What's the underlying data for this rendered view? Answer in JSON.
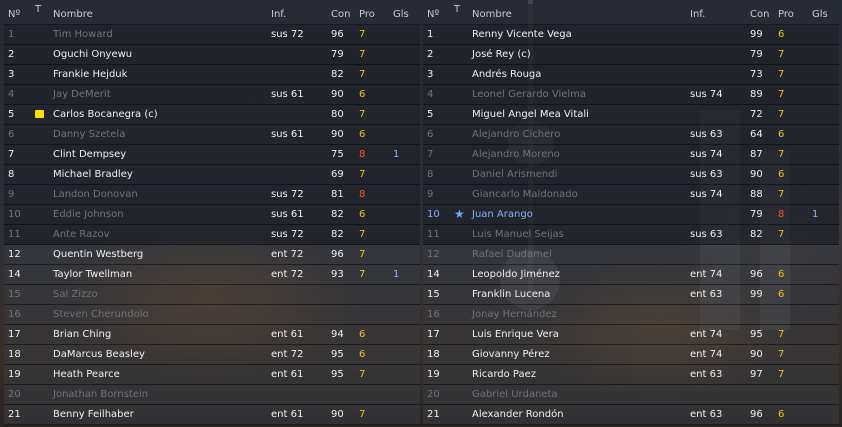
{
  "headers": {
    "no": "Nº",
    "t": "T",
    "name": "Nombre",
    "inf": "Inf.",
    "con": "Con",
    "pro": "Pro",
    "gls": "Gls"
  },
  "colors": {
    "white": "#f1f1f1",
    "grey": "#6f737a",
    "blue": "#7fb3ff",
    "pro_yellow": "#f3c21f",
    "pro_orange": "#f39a1a",
    "pro_red": "#f05a1e",
    "card_yellow": "#ffe000"
  },
  "left_team": [
    {
      "no": "1",
      "name": "Tim Howard",
      "inf": "sus 72",
      "con": "96",
      "pro": "7",
      "gls": "",
      "style": "g",
      "pc": "y",
      "grp": 1
    },
    {
      "no": "2",
      "name": "Oguchi Onyewu",
      "inf": "",
      "con": "79",
      "pro": "7",
      "gls": "",
      "style": "w",
      "pc": "y",
      "grp": 1
    },
    {
      "no": "3",
      "name": "Frankie Hejduk",
      "inf": "",
      "con": "82",
      "pro": "7",
      "gls": "",
      "style": "w",
      "pc": "y",
      "grp": 1
    },
    {
      "no": "4",
      "name": "Jay DeMerit",
      "inf": "sus 61",
      "con": "90",
      "pro": "6",
      "gls": "",
      "style": "g",
      "pc": "y",
      "grp": 1
    },
    {
      "no": "5",
      "name": "Carlos Bocanegra (c)",
      "inf": "",
      "con": "80",
      "pro": "7",
      "gls": "",
      "style": "w",
      "pc": "y",
      "grp": 1,
      "icon": "yellow-card-icon"
    },
    {
      "no": "6",
      "name": "Danny Szetela",
      "inf": "sus 61",
      "con": "90",
      "pro": "6",
      "gls": "",
      "style": "g",
      "pc": "y",
      "grp": 1
    },
    {
      "no": "7",
      "name": "Clint Dempsey",
      "inf": "",
      "con": "75",
      "pro": "8",
      "gls": "1",
      "style": "w",
      "pc": "r",
      "grp": 1
    },
    {
      "no": "8",
      "name": "Michael Bradley",
      "inf": "",
      "con": "69",
      "pro": "7",
      "gls": "",
      "style": "w",
      "pc": "y",
      "grp": 1
    },
    {
      "no": "9",
      "name": "Landon Donovan",
      "inf": "sus 72",
      "con": "81",
      "pro": "8",
      "gls": "",
      "style": "g",
      "pc": "r",
      "grp": 1
    },
    {
      "no": "10",
      "name": "Eddie Johnson",
      "inf": "sus 61",
      "con": "82",
      "pro": "6",
      "gls": "",
      "style": "g",
      "pc": "y",
      "grp": 1
    },
    {
      "no": "11",
      "name": "Ante Razov",
      "inf": "sus 72",
      "con": "82",
      "pro": "7",
      "gls": "",
      "style": "g",
      "pc": "y",
      "grp": 1
    },
    {
      "no": "12",
      "name": "Quentin Westberg",
      "inf": "ent 72",
      "con": "96",
      "pro": "7",
      "gls": "",
      "style": "w",
      "pc": "y",
      "grp": 2
    },
    {
      "no": "14",
      "name": "Taylor Twellman",
      "inf": "ent 72",
      "con": "93",
      "pro": "7",
      "gls": "1",
      "style": "w",
      "pc": "y",
      "grp": 2
    },
    {
      "no": "15",
      "name": "Sal Zizzo",
      "inf": "",
      "con": "",
      "pro": "",
      "gls": "",
      "style": "g",
      "pc": "y",
      "grp": 2
    },
    {
      "no": "16",
      "name": "Steven Cherundolo",
      "inf": "",
      "con": "",
      "pro": "",
      "gls": "",
      "style": "g",
      "pc": "y",
      "grp": 2
    },
    {
      "no": "17",
      "name": "Brian Ching",
      "inf": "ent 61",
      "con": "94",
      "pro": "6",
      "gls": "",
      "style": "w",
      "pc": "y",
      "grp": 2
    },
    {
      "no": "18",
      "name": "DaMarcus Beasley",
      "inf": "ent 72",
      "con": "95",
      "pro": "6",
      "gls": "",
      "style": "w",
      "pc": "y",
      "grp": 2
    },
    {
      "no": "19",
      "name": "Heath Pearce",
      "inf": "ent 61",
      "con": "95",
      "pro": "7",
      "gls": "",
      "style": "w",
      "pc": "y",
      "grp": 2
    },
    {
      "no": "20",
      "name": "Jonathan Bornstein",
      "inf": "",
      "con": "",
      "pro": "",
      "gls": "",
      "style": "g",
      "pc": "y",
      "grp": 2
    },
    {
      "no": "21",
      "name": "Benny Feilhaber",
      "inf": "ent 61",
      "con": "90",
      "pro": "7",
      "gls": "",
      "style": "w",
      "pc": "y",
      "grp": 2
    }
  ],
  "right_team": [
    {
      "no": "1",
      "name": "Renny Vicente Vega",
      "inf": "",
      "con": "99",
      "pro": "6",
      "gls": "",
      "style": "w",
      "pc": "y",
      "grp": 1
    },
    {
      "no": "2",
      "name": "José Rey (c)",
      "inf": "",
      "con": "79",
      "pro": "7",
      "gls": "",
      "style": "w",
      "pc": "y",
      "grp": 1
    },
    {
      "no": "3",
      "name": "Andrés Rouga",
      "inf": "",
      "con": "73",
      "pro": "7",
      "gls": "",
      "style": "w",
      "pc": "y",
      "grp": 1
    },
    {
      "no": "4",
      "name": "Leonel Gerardo Vielma",
      "inf": "sus 74",
      "con": "89",
      "pro": "7",
      "gls": "",
      "style": "g",
      "pc": "y",
      "grp": 1
    },
    {
      "no": "5",
      "name": "Miguel Angel Mea Vitali",
      "inf": "",
      "con": "72",
      "pro": "7",
      "gls": "",
      "style": "w",
      "pc": "y",
      "grp": 1
    },
    {
      "no": "6",
      "name": "Alejandro Cichero",
      "inf": "sus 63",
      "con": "64",
      "pro": "6",
      "gls": "",
      "style": "g",
      "pc": "y",
      "grp": 1
    },
    {
      "no": "7",
      "name": "Alejandro Moreno",
      "inf": "sus 74",
      "con": "87",
      "pro": "7",
      "gls": "",
      "style": "g",
      "pc": "y",
      "grp": 1
    },
    {
      "no": "8",
      "name": "Daniel Arismendi",
      "inf": "sus 63",
      "con": "90",
      "pro": "6",
      "gls": "",
      "style": "g",
      "pc": "y",
      "grp": 1
    },
    {
      "no": "9",
      "name": "Giancarlo Maldonado",
      "inf": "sus 74",
      "con": "88",
      "pro": "7",
      "gls": "",
      "style": "g",
      "pc": "y",
      "grp": 1
    },
    {
      "no": "10",
      "name": "Juan Arango",
      "inf": "",
      "con": "79",
      "pro": "8",
      "gls": "1",
      "style": "b",
      "pc": "r",
      "grp": 1,
      "icon": "star-icon"
    },
    {
      "no": "11",
      "name": "Luis Manuel Seijas",
      "inf": "sus 63",
      "con": "82",
      "pro": "7",
      "gls": "",
      "style": "g",
      "pc": "y",
      "grp": 1
    },
    {
      "no": "12",
      "name": "Rafael Dudamel",
      "inf": "",
      "con": "",
      "pro": "",
      "gls": "",
      "style": "g",
      "pc": "y",
      "grp": 2
    },
    {
      "no": "14",
      "name": "Leopoldo Jiménez",
      "inf": "ent 74",
      "con": "96",
      "pro": "6",
      "gls": "",
      "style": "w",
      "pc": "y",
      "grp": 2
    },
    {
      "no": "15",
      "name": "Franklin Lucena",
      "inf": "ent 63",
      "con": "99",
      "pro": "6",
      "gls": "",
      "style": "w",
      "pc": "y",
      "grp": 2
    },
    {
      "no": "16",
      "name": "Jonay Hernández",
      "inf": "",
      "con": "",
      "pro": "",
      "gls": "",
      "style": "g",
      "pc": "y",
      "grp": 2
    },
    {
      "no": "17",
      "name": "Luis Enrique Vera",
      "inf": "ent 74",
      "con": "95",
      "pro": "7",
      "gls": "",
      "style": "w",
      "pc": "y",
      "grp": 2
    },
    {
      "no": "18",
      "name": "Giovanny Pérez",
      "inf": "ent 74",
      "con": "90",
      "pro": "7",
      "gls": "",
      "style": "w",
      "pc": "y",
      "grp": 2
    },
    {
      "no": "19",
      "name": "Ricardo Paez",
      "inf": "ent 63",
      "con": "97",
      "pro": "7",
      "gls": "",
      "style": "w",
      "pc": "y",
      "grp": 2
    },
    {
      "no": "20",
      "name": "Gabriel Urdaneta",
      "inf": "",
      "con": "",
      "pro": "",
      "gls": "",
      "style": "g",
      "pc": "y",
      "grp": 2
    },
    {
      "no": "21",
      "name": "Alexander Rondón",
      "inf": "ent 63",
      "con": "96",
      "pro": "6",
      "gls": "",
      "style": "w",
      "pc": "y",
      "grp": 2
    }
  ]
}
